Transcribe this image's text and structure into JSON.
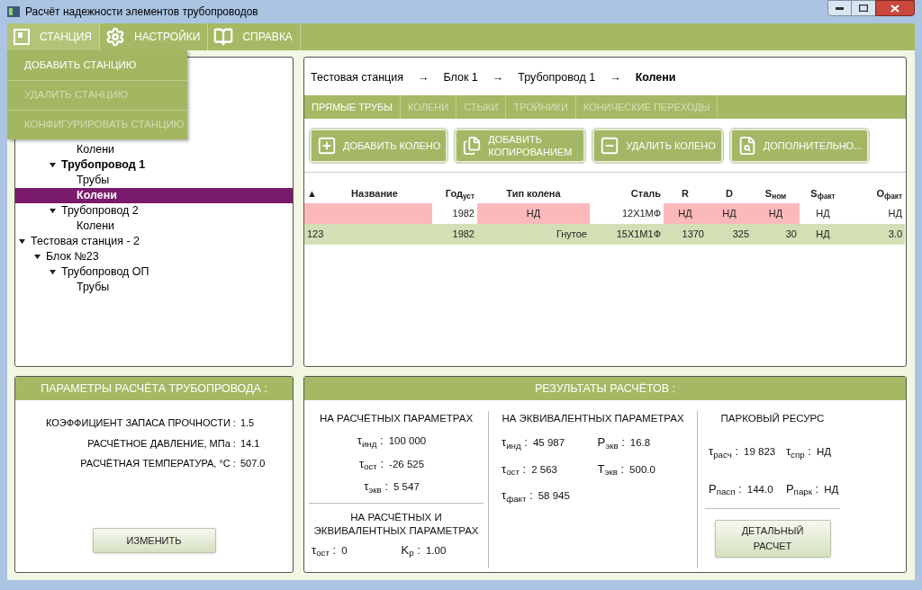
{
  "window": {
    "title": "Расчёт надежности элементов трубопроводов"
  },
  "menu": [
    {
      "label": "СТАНЦИЯ",
      "kind": "panel",
      "open": true
    },
    {
      "label": "НАСТРОЙКИ",
      "kind": "gear",
      "open": false
    },
    {
      "label": "СПРАВКА",
      "kind": "book",
      "open": false
    }
  ],
  "dropdown": [
    {
      "label": "ДОБАВИТЬ СТАНЦИЮ",
      "disabled": false
    },
    {
      "label": "УДАЛИТЬ СТАНЦИЮ",
      "disabled": true
    },
    {
      "label": "КОНФИГУРИРОВАТЬ СТАНЦИЮ",
      "disabled": true
    }
  ],
  "tree": [
    {
      "children": [
        {
          "children": [
            {
              "children": [
                {
                  "label": "Колени",
                  "selected": false
                }
              ]
            },
            {
              "label": "Трубопровод 1",
              "expanded": true,
              "active": true,
              "children": [
                {
                  "label": "Трубы",
                  "selected": false
                },
                {
                  "label": "Колени",
                  "selected": true
                }
              ]
            },
            {
              "label": "Трубопровод 2",
              "expanded": true,
              "active": false,
              "children": [
                {
                  "label": "Колени",
                  "selected": false
                }
              ]
            }
          ]
        }
      ]
    },
    {
      "label": "Тестовая станция - 2",
      "expanded": true,
      "active": false,
      "children": [
        {
          "label": "Блок №23",
          "expanded": true,
          "active": false,
          "children": [
            {
              "label": "Трубопровод ОП",
              "expanded": true,
              "active": false,
              "children": [
                {
                  "label": "Трубы",
                  "selected": false
                }
              ]
            }
          ]
        }
      ]
    }
  ],
  "breadcrumb": {
    "separator": "→",
    "items": [
      "Тестовая станция",
      "Блок 1",
      "Трубопровод 1",
      "Колени"
    ]
  },
  "tabs": [
    {
      "label": "ПРЯМЫЕ ТРУБЫ",
      "selected": true
    },
    {
      "label": "КОЛЕНИ",
      "selected": false
    },
    {
      "label": "СТЫКИ",
      "selected": false
    },
    {
      "label": "ТРОЙНИКИ",
      "selected": false
    },
    {
      "label": "КОНИЧЕСКИЕ ПЕРЕХОДЫ",
      "selected": false
    }
  ],
  "actions": [
    {
      "label": "ДОБАВИТЬ КОЛЕНО",
      "kind": "add"
    },
    {
      "label": "ДОБАВИТЬ КОПИРОВАНИЕМ",
      "kind": "copy"
    },
    {
      "label": "УДАЛИТЬ КОЛЕНО",
      "kind": "remove"
    },
    {
      "label": "ДОПОЛНИТЕЛЬНО...",
      "kind": "more"
    }
  ],
  "table": {
    "sort_indicator": "▲",
    "columns": [
      "Название",
      "Год$_{уст}$",
      "Тип колена",
      "Сталь",
      "R",
      "D",
      "S$_{ном}$",
      "S$_{факт}$",
      "О$_{факт}$"
    ],
    "rows": [
      {
        "selected": false,
        "cells": [
          {
            "invalid": true
          },
          {
            "text": "1982",
            "invalid": false
          },
          {
            "text": "НД",
            "invalid": true
          },
          {
            "text": "12Х1МФ",
            "invalid": false
          },
          {
            "text": "НД",
            "invalid": true
          },
          {
            "text": "НД",
            "invalid": true
          },
          {
            "text": "НД",
            "invalid": true
          },
          {
            "text": "НД",
            "invalid": false
          },
          {
            "text": "НД",
            "invalid": false
          }
        ]
      },
      {
        "selected": true,
        "cells": [
          {
            "text": "123",
            "invalid": false
          },
          {
            "text": "1982",
            "invalid": false
          },
          {
            "text": "Гнутое",
            "invalid": false
          },
          {
            "text": "15Х1М1Ф",
            "invalid": false
          },
          {
            "text": "1370",
            "invalid": false
          },
          {
            "text": "325",
            "invalid": false
          },
          {
            "text": "30",
            "invalid": false
          },
          {
            "text": "НД",
            "invalid": false
          },
          {
            "text": "3.0",
            "invalid": false
          }
        ]
      }
    ]
  },
  "pipeline_params": {
    "title": "ПАРАМЕТРЫ РАСЧЁТА ТРУБОПРОВОДА :",
    "items": [
      {
        "label": "КОЭФФИЦИЕНТ ЗАПАСА ПРОЧНОСТИ :",
        "value": "1.5"
      },
      {
        "label": "РАСЧЁТНОЕ ДАВЛЕНИЕ, МПа :",
        "value": "14.1"
      },
      {
        "label": "РАСЧЁТНАЯ ТЕМПЕРАТУРА, °С :",
        "value": "507.0"
      }
    ],
    "button": "ИЗМЕНИТЬ"
  },
  "results": {
    "title": "РЕЗУЛЬТАТЫ РАСЧЁТОВ :",
    "design": {
      "title": "НА РАСЧЁТНЫХ ПАРАМЕТРАХ",
      "items": [
        {
          "label": "τ$_{инд}$ :",
          "value": "100 000"
        },
        {
          "label": "τ$_{ост}$ :",
          "value": "-26 525"
        },
        {
          "label": "τ$_{экв}$ :",
          "value": "5 547"
        }
      ]
    },
    "combined": {
      "title": "НА РАСЧЁТНЫХ И ЭКВИВАЛЕНТНЫХ ПАРАМЕТРАХ",
      "items": [
        {
          "label": "τ$_{ост}$ :",
          "value": "0"
        },
        {
          "label": "K$_{р}$ :",
          "value": "1.00"
        }
      ]
    },
    "equivalent": {
      "title": "НА ЭКВИВАЛЕНТНЫХ ПАРАМЕТРАХ",
      "items": [
        {
          "label": "τ$_{инд}$ :",
          "value": "45 987"
        },
        {
          "label": "Р$_{экв}$ :",
          "value": "16.8"
        },
        {
          "label": "τ$_{ост}$ :",
          "value": "2 563"
        },
        {
          "label": "Т$_{экв}$ :",
          "value": "500.0"
        },
        {
          "label": "τ$_{факт}$ :",
          "value": "58 945"
        }
      ]
    },
    "park": {
      "title": "ПАРКОВЫЙ РЕСУРС",
      "items": [
        {
          "label": "τ$_{расч}$ :",
          "value": "19 823"
        },
        {
          "label": "τ$_{спр}$ :",
          "value": "НД"
        },
        {
          "label": "Р$_{пасп}$ :",
          "value": "144.0"
        },
        {
          "label": "Р$_{парк}$ :",
          "value": "НД"
        }
      ],
      "button": "ДЕТАЛЬНЫЙ РАСЧЕТ"
    }
  }
}
